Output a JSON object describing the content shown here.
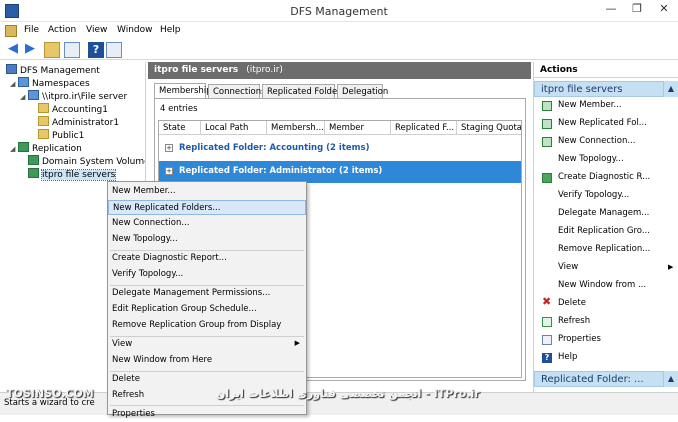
{
  "window": {
    "title": "DFS Management",
    "min": "—",
    "max": "❐",
    "close": "✕"
  },
  "menu": [
    "File",
    "Action",
    "View",
    "Window",
    "Help"
  ],
  "tree": {
    "root": "DFS Management",
    "namespaces": "Namespaces",
    "namespace_path": "\\\\itpro.ir\\File server",
    "folders": [
      "Accounting1",
      "Administrator1",
      "Public1"
    ],
    "replication": "Replication",
    "groups": [
      "Domain System Volume",
      "itpro file servers"
    ]
  },
  "center": {
    "header_title": "itpro file servers",
    "header_sub": "(itpro.ir)",
    "tabs": [
      "Memberships",
      "Connections",
      "Replicated Folders",
      "Delegation"
    ],
    "entries": "4 entries",
    "columns": [
      "State",
      "Local Path",
      "Membersh...",
      "Member",
      "Replicated F...",
      "Staging Quota"
    ],
    "groups": [
      "Replicated Folder: Accounting (2 items)",
      "Replicated Folder: Administrator (2 items)"
    ]
  },
  "actions": {
    "title": "Actions",
    "section1": "itpro file servers",
    "items": [
      "New Member...",
      "New Replicated Fol...",
      "New Connection...",
      "New Topology...",
      "Create Diagnostic R...",
      "Verify Topology...",
      "Delegate Managem...",
      "Edit Replication Gro...",
      "Remove Replication...",
      "View",
      "New Window from ...",
      "Delete",
      "Refresh",
      "Properties",
      "Help"
    ],
    "section2": "Replicated Folder: ..."
  },
  "context_menu": {
    "items": [
      "New Member...",
      "New Replicated Folders...",
      "New Connection...",
      "New Topology...",
      "Create Diagnostic Report...",
      "Verify Topology...",
      "Delegate Management Permissions...",
      "Edit Replication Group Schedule...",
      "Remove Replication Group from Display",
      "View",
      "New Window from Here",
      "Delete",
      "Refresh",
      "Properties"
    ]
  },
  "status": {
    "text": "Starts a wizard to cre"
  },
  "watermark": {
    "left": "TOSINSO.COM",
    "right": "انجمن تخصصی فناوری اطلاعات ایران - ITPro.ir"
  }
}
